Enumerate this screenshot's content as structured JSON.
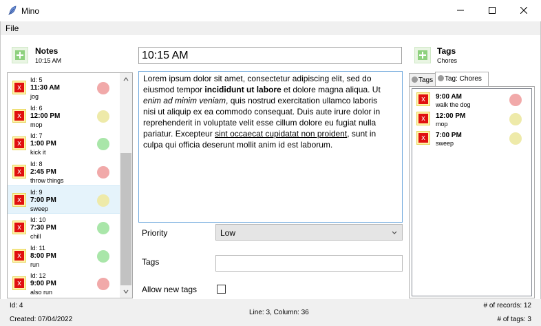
{
  "window": {
    "title": "Mino"
  },
  "menu": {
    "file": "File"
  },
  "notes_header": {
    "title": "Notes",
    "subtitle": "10:15 AM"
  },
  "tags_header": {
    "title": "Tags",
    "subtitle": "Chores"
  },
  "notes": [
    {
      "id": "Id: 5",
      "time": "11:30 AM",
      "text": "jog",
      "priority_color": "#f1a9a9",
      "selected": false
    },
    {
      "id": "Id: 6",
      "time": "12:00 PM",
      "text": "mop",
      "priority_color": "#eeeaa9",
      "selected": false
    },
    {
      "id": "Id: 7",
      "time": "1:00 PM",
      "text": "kick it",
      "priority_color": "#a9e6a9",
      "selected": false
    },
    {
      "id": "Id: 8",
      "time": "2:45 PM",
      "text": "throw things",
      "priority_color": "#f1a9a9",
      "selected": false
    },
    {
      "id": "Id: 9",
      "time": "7:00 PM",
      "text": "sweep",
      "priority_color": "#eeeaa9",
      "selected": true
    },
    {
      "id": "Id: 10",
      "time": "7:30 PM",
      "text": "chill",
      "priority_color": "#a9e6a9",
      "selected": false
    },
    {
      "id": "Id: 11",
      "time": "8:00 PM",
      "text": "run",
      "priority_color": "#a9e6a9",
      "selected": false
    },
    {
      "id": "Id: 12",
      "time": "9:00 PM",
      "text": "also run",
      "priority_color": "#f1a9a9",
      "selected": false
    }
  ],
  "editor": {
    "time_value": "10:15 AM",
    "segments": [
      {
        "t": "Lorem ipsum dolor sit amet, consectetur adipiscing elit, sed do eiusmod tempor ",
        "s": ""
      },
      {
        "t": "incididunt ut labore",
        "s": "b"
      },
      {
        "t": " et dolore magna aliqua. Ut ",
        "s": ""
      },
      {
        "t": "enim ad minim veniam",
        "s": "i"
      },
      {
        "t": ", quis nostrud exercitation ullamco laboris nisi ut aliquip ex ea commodo consequat. Duis aute irure dolor in reprehenderit in voluptate velit esse cillum dolore eu fugiat nulla pariatur. Excepteur ",
        "s": ""
      },
      {
        "t": "sint occaecat cupidatat non proident",
        "s": "u"
      },
      {
        "t": ", sunt in culpa qui officia deserunt mollit anim id est laborum.",
        "s": ""
      }
    ]
  },
  "form": {
    "priority_label": "Priority",
    "priority_value": "Low",
    "tags_label": "Tags",
    "tags_value": "",
    "allow_new_tags_label": "Allow new tags",
    "allow_new_tags_checked": false
  },
  "tabs": [
    {
      "label": "Tags",
      "active": false
    },
    {
      "label": "Tag: Chores",
      "active": true
    }
  ],
  "tag_notes": [
    {
      "time": "9:00 AM",
      "text": "walk the dog",
      "priority_color": "#f1a9a9"
    },
    {
      "time": "12:00 PM",
      "text": "mop",
      "priority_color": "#eeeaa9"
    },
    {
      "time": "7:00 PM",
      "text": "sweep",
      "priority_color": "#eeeaa9"
    }
  ],
  "status": {
    "id": "Id: 4",
    "created": "Created: 07/04/2022",
    "position": "Line: 3, Column: 36",
    "records": "# of records: 12",
    "tags_count": "# of tags: 3"
  },
  "colors": {
    "delete_button_bg": "#e01010",
    "delete_button_border": "#fff3a8",
    "add_button": "#8ed17e",
    "selection": "#e5f3fb"
  }
}
